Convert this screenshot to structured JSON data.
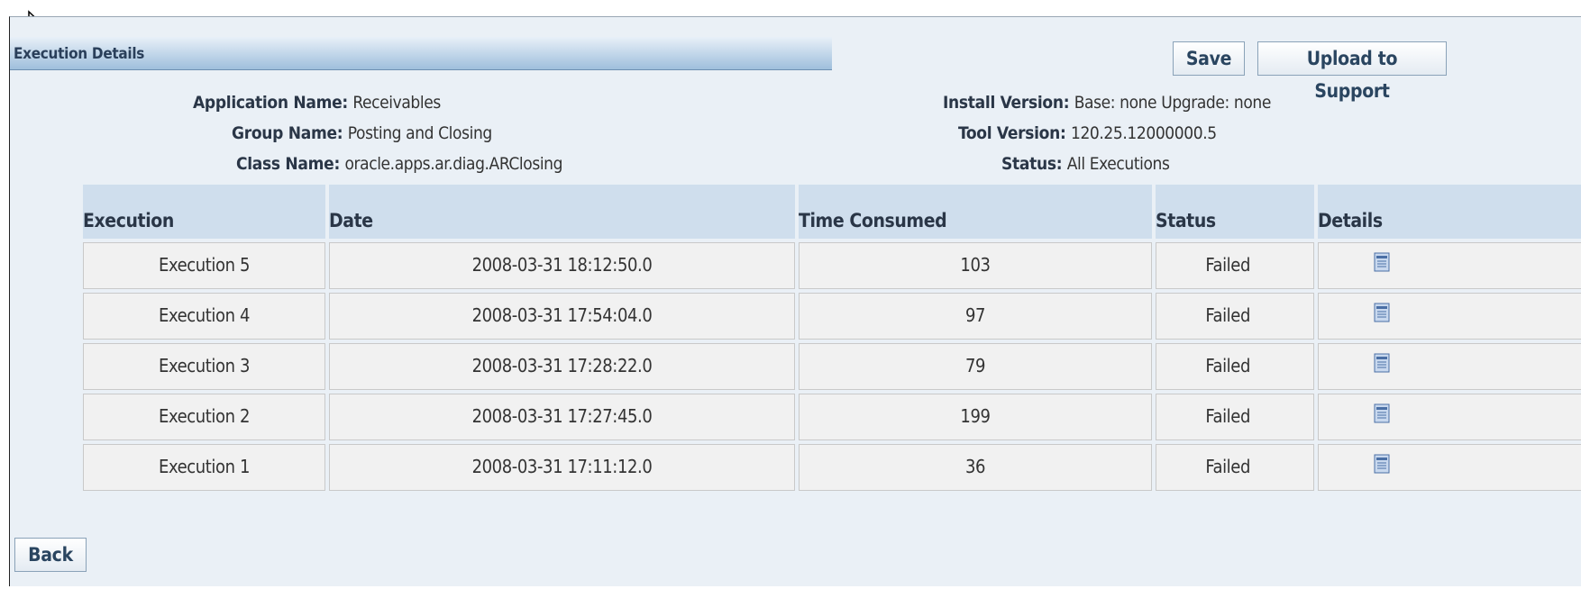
{
  "header": {
    "title": "Execution Details"
  },
  "actions": {
    "save_label": "Save",
    "upload_label": "Upload to Support",
    "back_label": "Back"
  },
  "info_left": {
    "application_label": "Application Name:",
    "application_value": "Receivables",
    "group_label": "Group Name:",
    "group_value": "Posting and Closing",
    "class_label": "Class Name:",
    "class_value": "oracle.apps.ar.diag.ARClosing"
  },
  "info_right": {
    "install_label": "Install Version:",
    "install_value": "Base: none Upgrade: none",
    "tool_label": "Tool Version:",
    "tool_value": "120.25.12000000.5",
    "status_label": "Status:",
    "status_value": "All Executions"
  },
  "table": {
    "columns": [
      "Execution",
      "Date",
      "Time Consumed",
      "Status",
      "Details"
    ],
    "rows": [
      {
        "execution": "Execution 5",
        "date": "2008-03-31 18:12:50.0",
        "time": "103",
        "status": "Failed",
        "details_icon": "details-icon"
      },
      {
        "execution": "Execution 4",
        "date": "2008-03-31 17:54:04.0",
        "time": "97",
        "status": "Failed",
        "details_icon": "details-icon"
      },
      {
        "execution": "Execution 3",
        "date": "2008-03-31 17:28:22.0",
        "time": "79",
        "status": "Failed",
        "details_icon": "details-icon"
      },
      {
        "execution": "Execution 2",
        "date": "2008-03-31 17:27:45.0",
        "time": "199",
        "status": "Failed",
        "details_icon": "details-icon"
      },
      {
        "execution": "Execution 1",
        "date": "2008-03-31 17:11:12.0",
        "time": "36",
        "status": "Failed",
        "details_icon": "details-icon"
      }
    ]
  },
  "colors": {
    "background": "#eaf0f6",
    "header_bar": "#9fbfdc",
    "table_header": "#cfdeed",
    "cell": "#f1f1f1"
  }
}
